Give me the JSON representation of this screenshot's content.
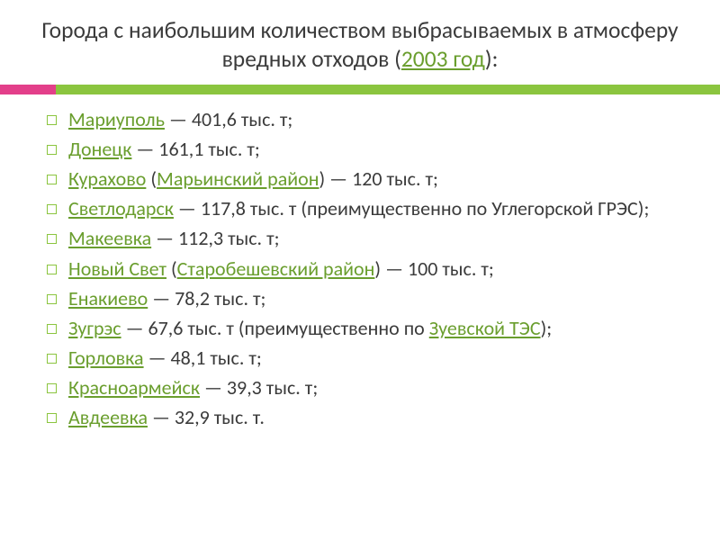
{
  "title": {
    "pre": "Города с наибольшим количеством выбрасываемых в атмосферу вредных отходов (",
    "link": "2003 год",
    "post": "):"
  },
  "items": [
    {
      "parts": [
        {
          "t": "Мариуполь",
          "link": true
        },
        {
          "t": " — 401,6 тыс. т;"
        }
      ]
    },
    {
      "parts": [
        {
          "t": "Донецк",
          "link": true
        },
        {
          "t": " — 161,1 тыс. т;"
        }
      ]
    },
    {
      "parts": [
        {
          "t": "Курахово",
          "link": true
        },
        {
          "t": " ("
        },
        {
          "t": "Марьинский район",
          "link": true
        },
        {
          "t": ") — 120 тыс. т;"
        }
      ]
    },
    {
      "parts": [
        {
          "t": "Светлодарск",
          "link": true
        },
        {
          "t": " — 117,8 тыс. т (преимущественно по Углегорской ГРЭС);"
        }
      ]
    },
    {
      "parts": [
        {
          "t": "Макеевка",
          "link": true
        },
        {
          "t": " — 112,3 тыс. т;"
        }
      ]
    },
    {
      "parts": [
        {
          "t": " "
        },
        {
          "t": "Новый Свет",
          "link": true
        },
        {
          "t": " ("
        },
        {
          "t": "Старобешевский район",
          "link": true
        },
        {
          "t": ") — 100 тыс. т;"
        }
      ]
    },
    {
      "parts": [
        {
          "t": "Енакиево",
          "link": true
        },
        {
          "t": " — 78,2 тыс. т;"
        }
      ]
    },
    {
      "parts": [
        {
          "t": "Зугрэс",
          "link": true
        },
        {
          "t": " — 67,6 тыс. т (преимущественно по "
        },
        {
          "t": "Зуевской ТЭС",
          "link": true
        },
        {
          "t": ");"
        }
      ]
    },
    {
      "parts": [
        {
          "t": "Горловка",
          "link": true
        },
        {
          "t": " — 48,1 тыс. т;"
        }
      ]
    },
    {
      "parts": [
        {
          "t": "Красноармейск",
          "link": true
        },
        {
          "t": " — 39,3 тыс. т;"
        }
      ]
    },
    {
      "parts": [
        {
          "t": "Авдеевка",
          "link": true
        },
        {
          "t": " — 32,9 тыс. т."
        }
      ]
    }
  ]
}
